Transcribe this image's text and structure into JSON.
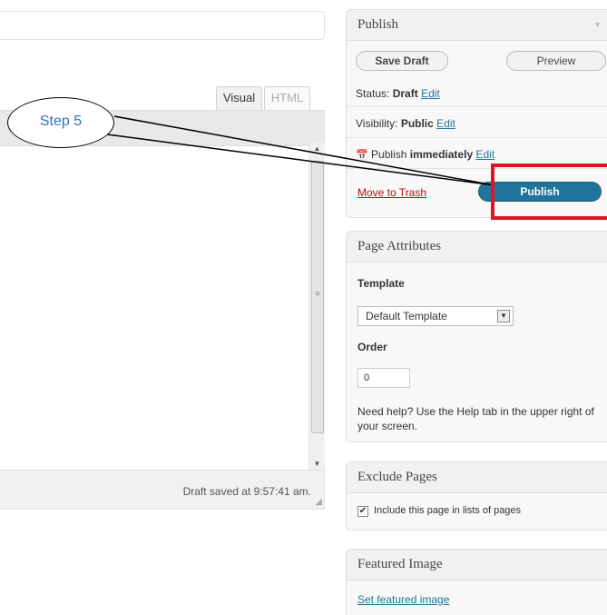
{
  "editor": {
    "tab_visual": "Visual",
    "tab_html": "HTML",
    "status": "Draft saved at 9:57:41 am."
  },
  "publish": {
    "title": "Publish",
    "save_draft": "Save Draft",
    "preview": "Preview",
    "status_label": "Status:",
    "status_value": "Draft",
    "status_edit": "Edit",
    "visibility_label": "Visibility:",
    "visibility_value": "Public",
    "visibility_edit": "Edit",
    "schedule_label": "Publish",
    "schedule_value": "immediately",
    "schedule_edit": "Edit",
    "trash": "Move to Trash",
    "publish_button": "Publish"
  },
  "page_attributes": {
    "title": "Page Attributes",
    "template_label": "Template",
    "template_value": "Default Template",
    "order_label": "Order",
    "order_value": "0",
    "help": "Need help? Use the Help tab in the upper right of your screen."
  },
  "exclude_pages": {
    "title": "Exclude Pages",
    "checkbox_label": "Include this page in lists of pages",
    "checked": true
  },
  "featured_image": {
    "title": "Featured Image",
    "link": "Set featured image"
  },
  "annotation": {
    "callout": "Step 5"
  },
  "colors": {
    "accent": "#21759b",
    "highlight": "#e0141e",
    "callout_text": "#2e74b5",
    "trash": "#bc0b0b"
  }
}
